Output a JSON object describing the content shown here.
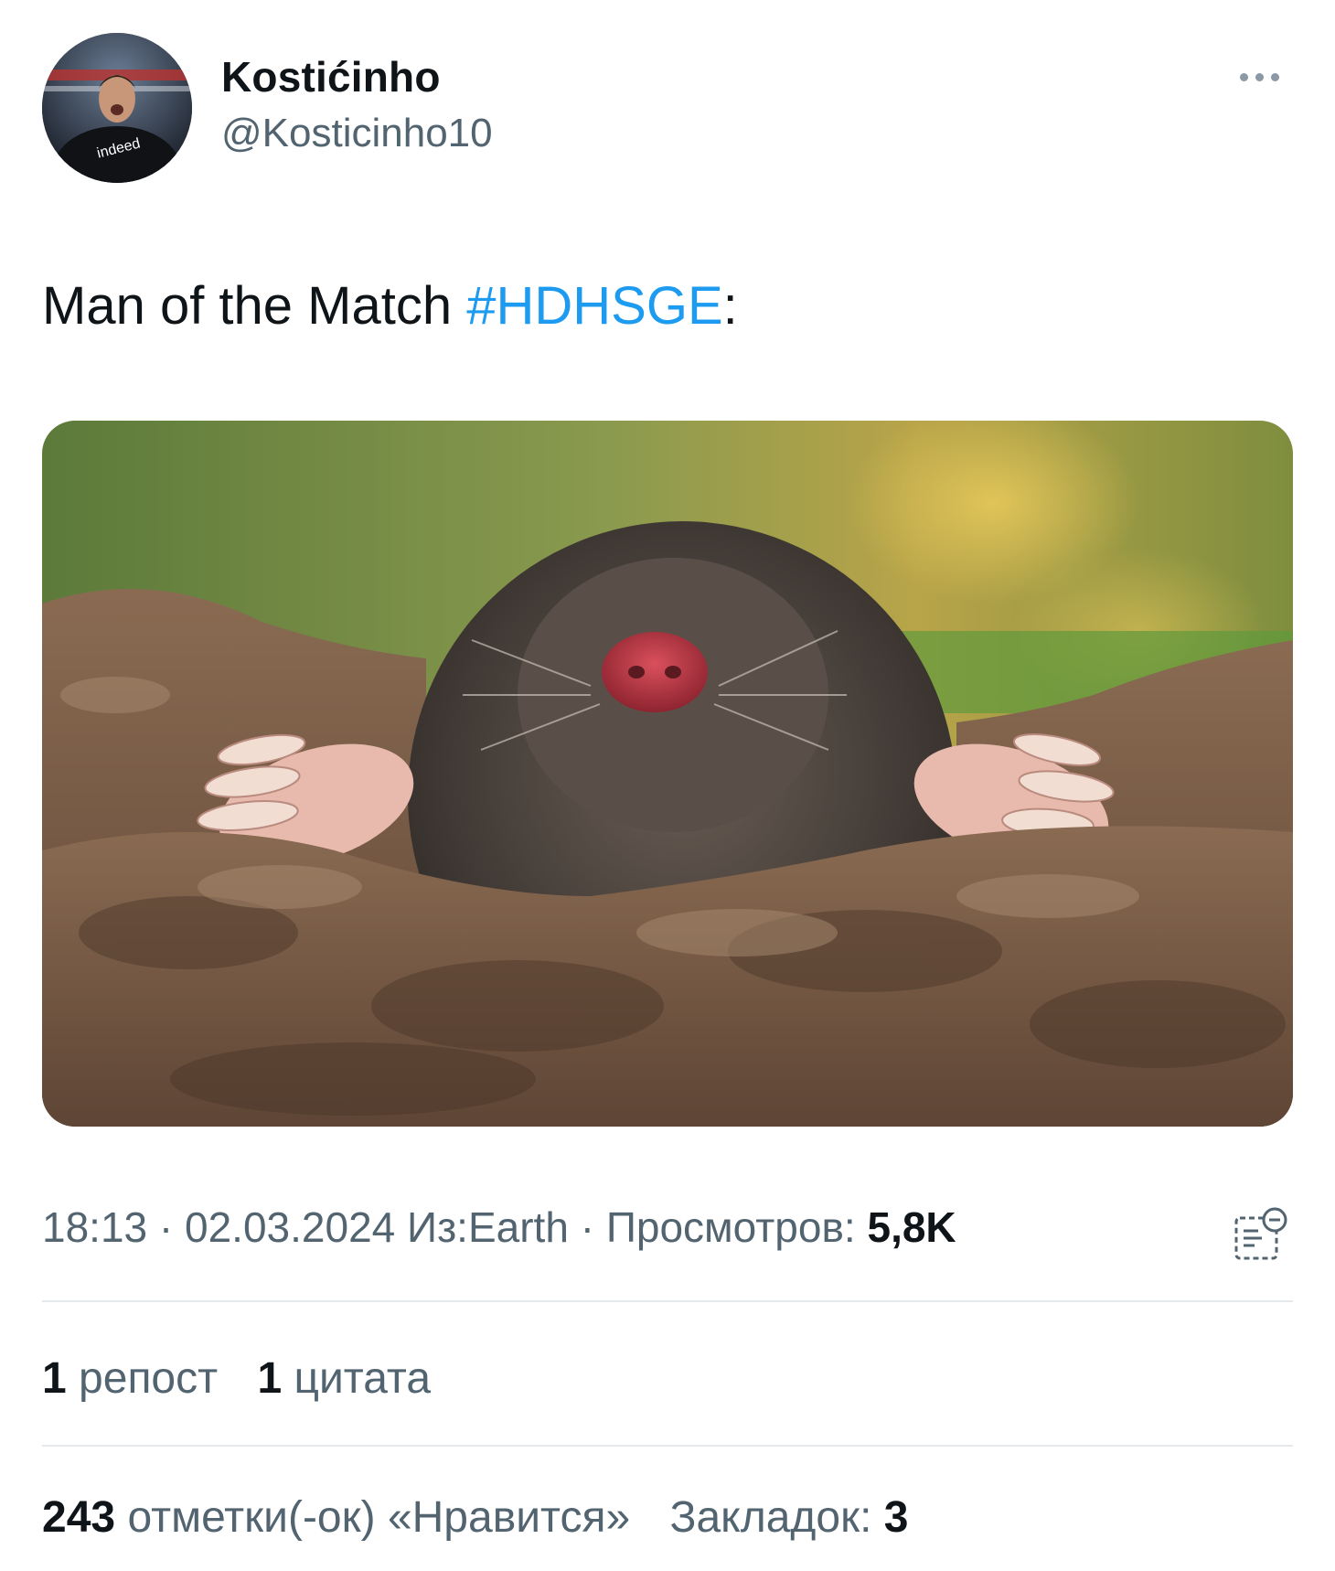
{
  "author": {
    "display_name": "Kostićinho",
    "handle": "@Kosticinho10",
    "avatar_text": "indeed"
  },
  "tweet": {
    "text_prefix": "Man of the Match ",
    "hashtag": "#HDHSGE",
    "text_suffix": ":"
  },
  "meta": {
    "time": "18:13",
    "separator": " · ",
    "date": "02.03.2024",
    "source": "Из:Earth",
    "views_label": "Просмотров: ",
    "views_value": "5,8K"
  },
  "stats": {
    "reposts_count": "1",
    "reposts_label": "репост",
    "quotes_count": "1",
    "quotes_label": "цитата",
    "likes_count": "243",
    "likes_label": "отметки(-ок) «Нравится»",
    "bookmarks_label": "Закладок: ",
    "bookmarks_count": "3"
  },
  "colors": {
    "link": "#1d9bf0",
    "secondary_text": "#536471",
    "primary_text": "#0f1419"
  },
  "icons": {
    "more": "more-horizontal-icon",
    "analytics": "analytics-icon"
  }
}
